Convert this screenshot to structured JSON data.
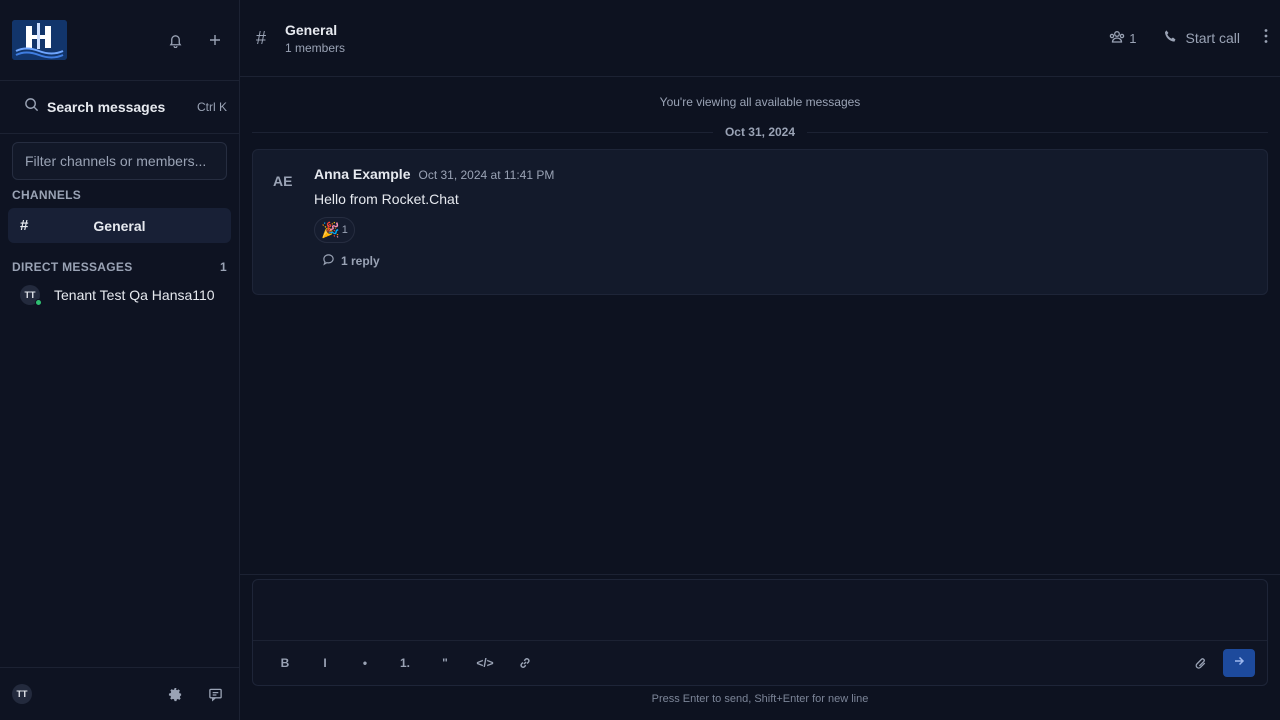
{
  "sidebar": {
    "search": {
      "label": "Search messages",
      "shortcut": "Ctrl K"
    },
    "filter": {
      "placeholder": "Filter channels or members..."
    },
    "channels_header": "CHANNELS",
    "channels": [
      {
        "icon": "#",
        "label": "General"
      }
    ],
    "dm_header": "DIRECT MESSAGES",
    "dm_count": "1",
    "direct_messages": [
      {
        "initials": "TT",
        "name": "Tenant Test Qa Hansa110",
        "status": "online"
      }
    ],
    "user_initials": "TT"
  },
  "header": {
    "icon": "#",
    "title": "General",
    "subtitle": "1 members",
    "members_count": "1",
    "call_label": "Start call"
  },
  "timeline": {
    "viewing_notice": "You're viewing all available messages",
    "date_divider": "Oct 31, 2024",
    "messages": [
      {
        "initials": "AE",
        "author": "Anna Example",
        "time": "Oct 31, 2024 at 11:41 PM",
        "text": "Hello from Rocket.Chat",
        "reaction": {
          "emoji": "🎉",
          "count": "1"
        },
        "replies": "1 reply"
      }
    ]
  },
  "composer": {
    "placeholder": "",
    "format_buttons": [
      "B",
      "I",
      "•",
      "1.",
      "\"",
      "</>"
    ],
    "hint": "Press Enter to send, Shift+Enter for new line"
  },
  "colors": {
    "accent": "#1d4a9c",
    "online": "#2fbf71",
    "background": "#0d1220"
  }
}
